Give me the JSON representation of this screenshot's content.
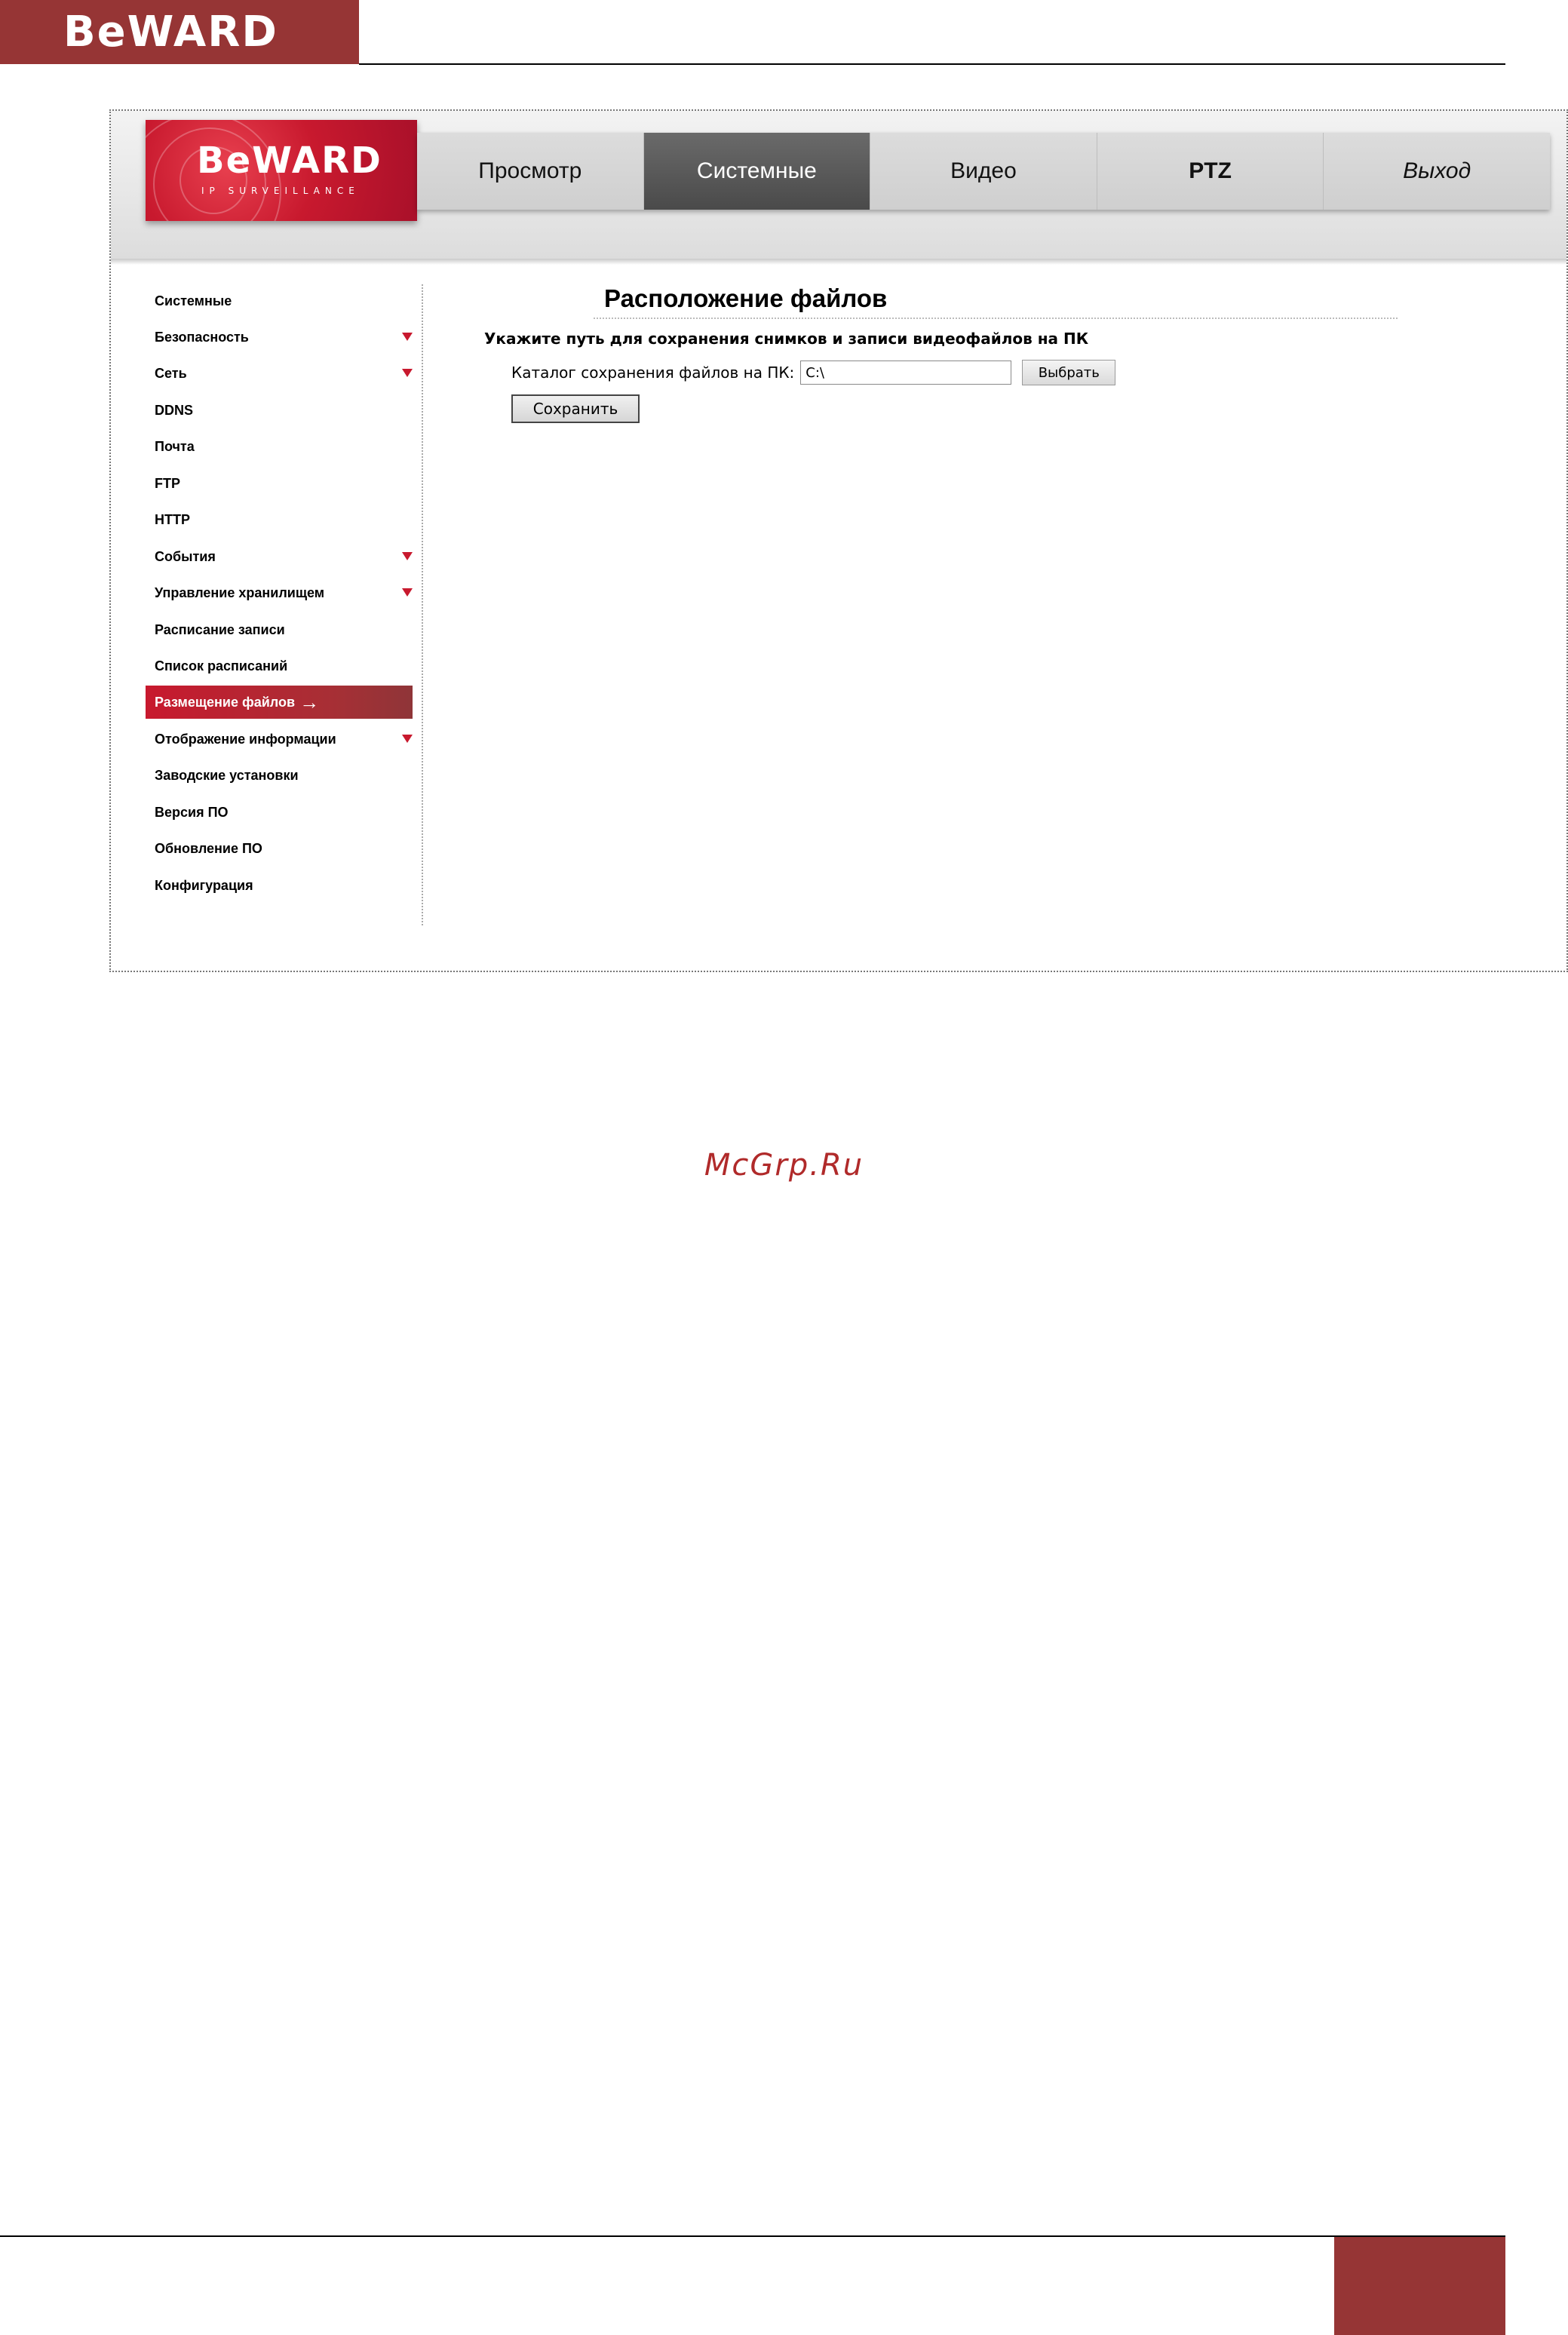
{
  "document": {
    "logo_text": "BeWARD",
    "watermark": "McGrp.Ru"
  },
  "app": {
    "logo_text": "BeWARD",
    "logo_subtitle": "IP SURVEILLANCE"
  },
  "nav": {
    "tabs": [
      {
        "label": "Просмотр"
      },
      {
        "label": "Системные"
      },
      {
        "label": "Видео"
      },
      {
        "label": "PTZ"
      },
      {
        "label": "Выход"
      }
    ]
  },
  "sidebar": {
    "items": [
      {
        "label": "Системные"
      },
      {
        "label": "Безопасность"
      },
      {
        "label": "Сеть"
      },
      {
        "label": "DDNS"
      },
      {
        "label": "Почта"
      },
      {
        "label": "FTP"
      },
      {
        "label": "HTTP"
      },
      {
        "label": "События"
      },
      {
        "label": "Управление хранилищем"
      },
      {
        "label": "Расписание записи"
      },
      {
        "label": "Список расписаний"
      },
      {
        "label": "Размещение файлов",
        "selected_marker": "→"
      },
      {
        "label": "Отображение информации"
      },
      {
        "label": "Заводские установки"
      },
      {
        "label": "Версия ПО"
      },
      {
        "label": "Обновление ПО"
      },
      {
        "label": "Конфигурация"
      }
    ]
  },
  "content": {
    "title": "Расположение файлов",
    "subtitle": "Укажите путь для сохранения снимков и записи видеофайлов на ПК",
    "path_label": "Каталог сохранения файлов на ПК:",
    "path_value": "C:\\",
    "browse_label": "Выбрать",
    "save_label": "Сохранить"
  },
  "colors": {
    "brand": "#963535",
    "accent": "#c8192e",
    "active_tab": "#4a4a4a"
  }
}
